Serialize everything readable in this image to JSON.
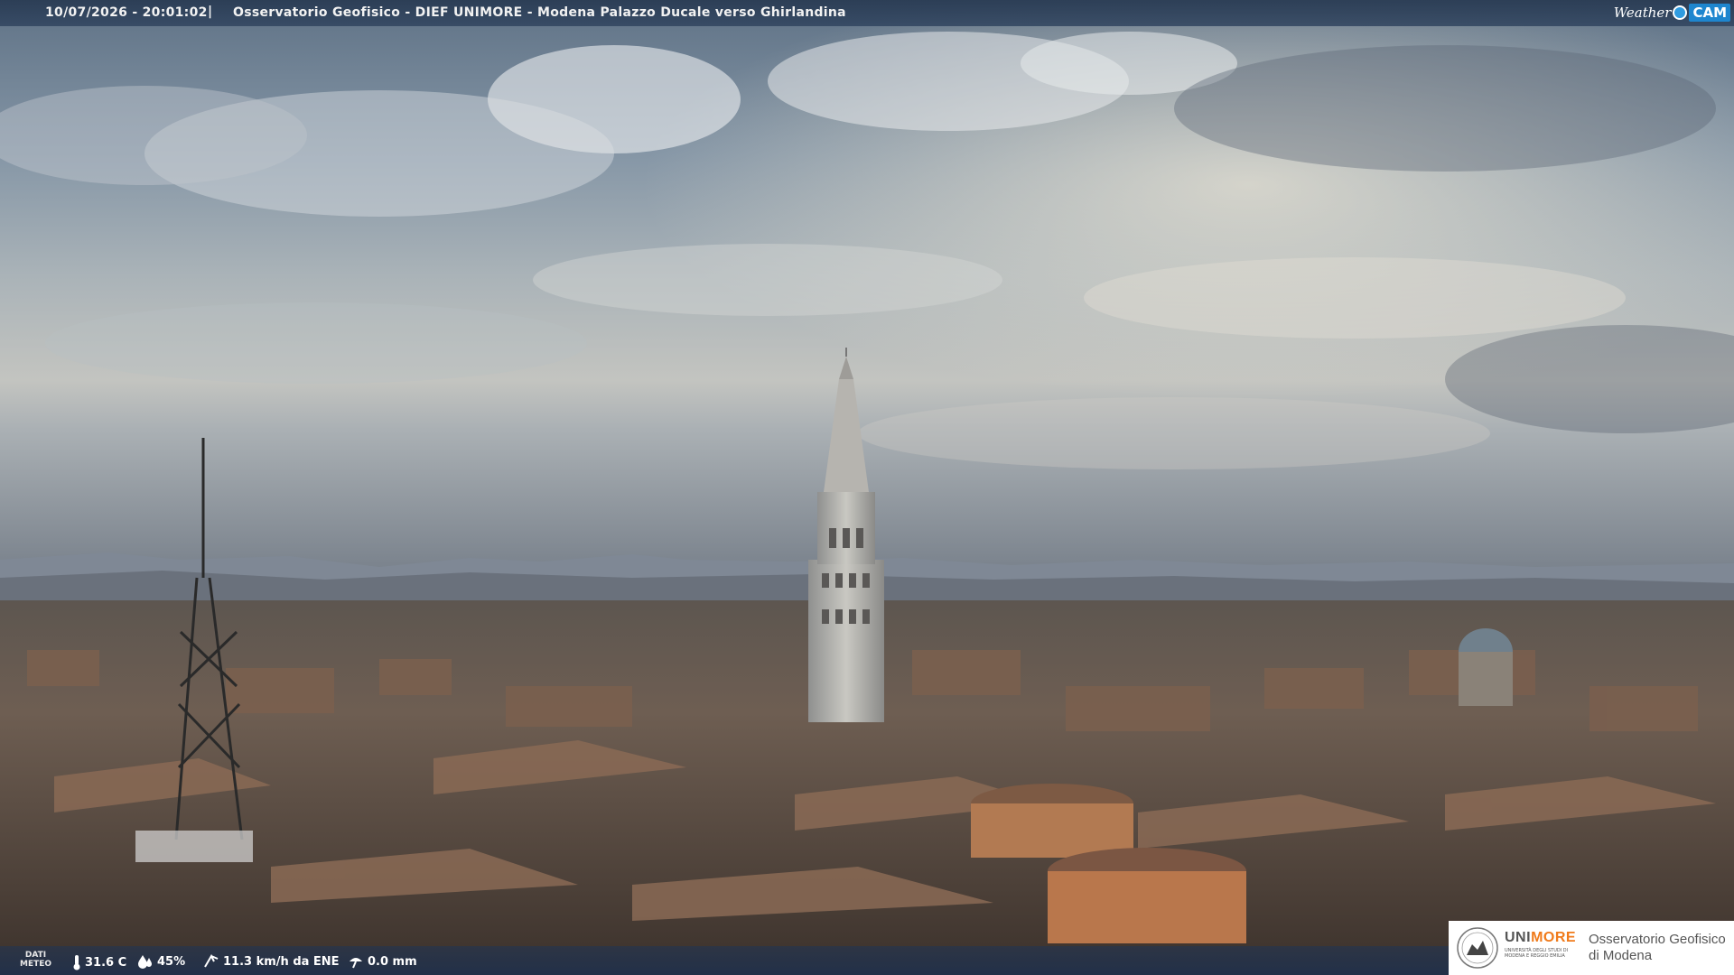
{
  "caption": {
    "datetime": "10/07/2026 - 20:01:02",
    "separator": "|",
    "title": "Osservatorio Geofisico - DIEF UNIMORE - Modena Palazzo Ducale verso Ghirlandina"
  },
  "webcam_logo": {
    "word1": "Weather",
    "word2": "CAM",
    "accent_color": "#1e86cf"
  },
  "weather_strip": {
    "label_line1": "DATI",
    "label_line2": "METEO",
    "temperature": "31.6 C",
    "humidity": "45%",
    "wind": "11.3 km/h da ENE",
    "rain": "0.0 mm",
    "icons": [
      "thermometer-icon",
      "humidity-drop-icon",
      "wind-icon",
      "rain-gauge-icon"
    ]
  },
  "institution_logo": {
    "name_part1": "UNI",
    "name_part2": "MORE",
    "subtitle": "UNIVERSITÀ DEGLI STUDI DI MODENA E REGGIO EMILIA",
    "observatory_line1": "Osservatorio Geofisico",
    "observatory_line2": "di Modena",
    "accent_color": "#f07a1a"
  }
}
